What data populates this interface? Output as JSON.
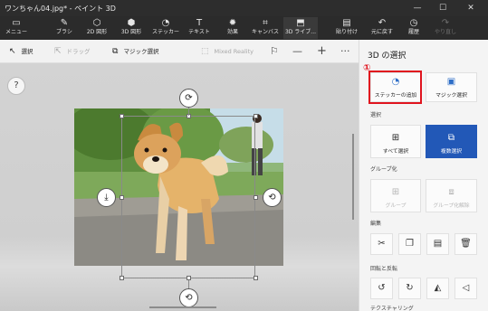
{
  "window": {
    "title": "ワンちゃん04.jpg* - ペイント 3D",
    "minimize": "—",
    "maximize": "☐",
    "close": "✕"
  },
  "toolbar": [
    {
      "id": "menu",
      "label": "メニュー",
      "icon": "folder-icon",
      "glyph": "▭"
    },
    {
      "id": "brush",
      "label": "ブラシ",
      "icon": "brush-icon",
      "glyph": "✎"
    },
    {
      "id": "2dshape",
      "label": "2D 図形",
      "icon": "2d-shape-icon",
      "glyph": "⬡"
    },
    {
      "id": "3dshape",
      "label": "3D 図形",
      "icon": "3d-shape-icon",
      "glyph": "⬢"
    },
    {
      "id": "sticker",
      "label": "ステッカー",
      "icon": "sticker-icon",
      "glyph": "◔"
    },
    {
      "id": "text",
      "label": "テキスト",
      "icon": "text-icon",
      "glyph": "T"
    },
    {
      "id": "effects",
      "label": "効果",
      "icon": "effects-icon",
      "glyph": "✹"
    },
    {
      "id": "canvas",
      "label": "キャンバス",
      "icon": "canvas-icon",
      "glyph": "⌗"
    },
    {
      "id": "3dlib",
      "label": "3D ライブ...",
      "icon": "3d-library-icon",
      "glyph": "⬒"
    },
    {
      "id": "paste",
      "label": "貼り付け",
      "icon": "paste-icon",
      "glyph": "▤"
    },
    {
      "id": "undo",
      "label": "元に戻す",
      "icon": "undo-icon",
      "glyph": "↶"
    },
    {
      "id": "history",
      "label": "履歴",
      "icon": "history-icon",
      "glyph": "◷"
    },
    {
      "id": "redo",
      "label": "やり直し",
      "icon": "redo-icon",
      "glyph": "↷"
    }
  ],
  "subbar": {
    "select": "選択",
    "drag": "ドラッグ",
    "magic_select": "マジック選択",
    "mixed_reality": "Mixed Reality",
    "minus": "—",
    "plus": "+",
    "more": "···"
  },
  "canvas": {
    "help": "?"
  },
  "panel": {
    "title": "3D の選択",
    "marker": "①",
    "add_sticker": "ステッカーの追加",
    "magic_select": "マジック選択",
    "section_select": "選択",
    "select_all": "すべて選択",
    "multi_select": "複数選択",
    "section_group": "グループ化",
    "group": "グループ",
    "ungroup": "グループ化解除",
    "section_edit": "編集",
    "section_rotate": "回転と反転",
    "section_texture": "テクスチャリング"
  },
  "colors": {
    "accent": "#2258b7",
    "highlight": "#e0141e",
    "toolbar_bg": "#2b2b2b"
  }
}
